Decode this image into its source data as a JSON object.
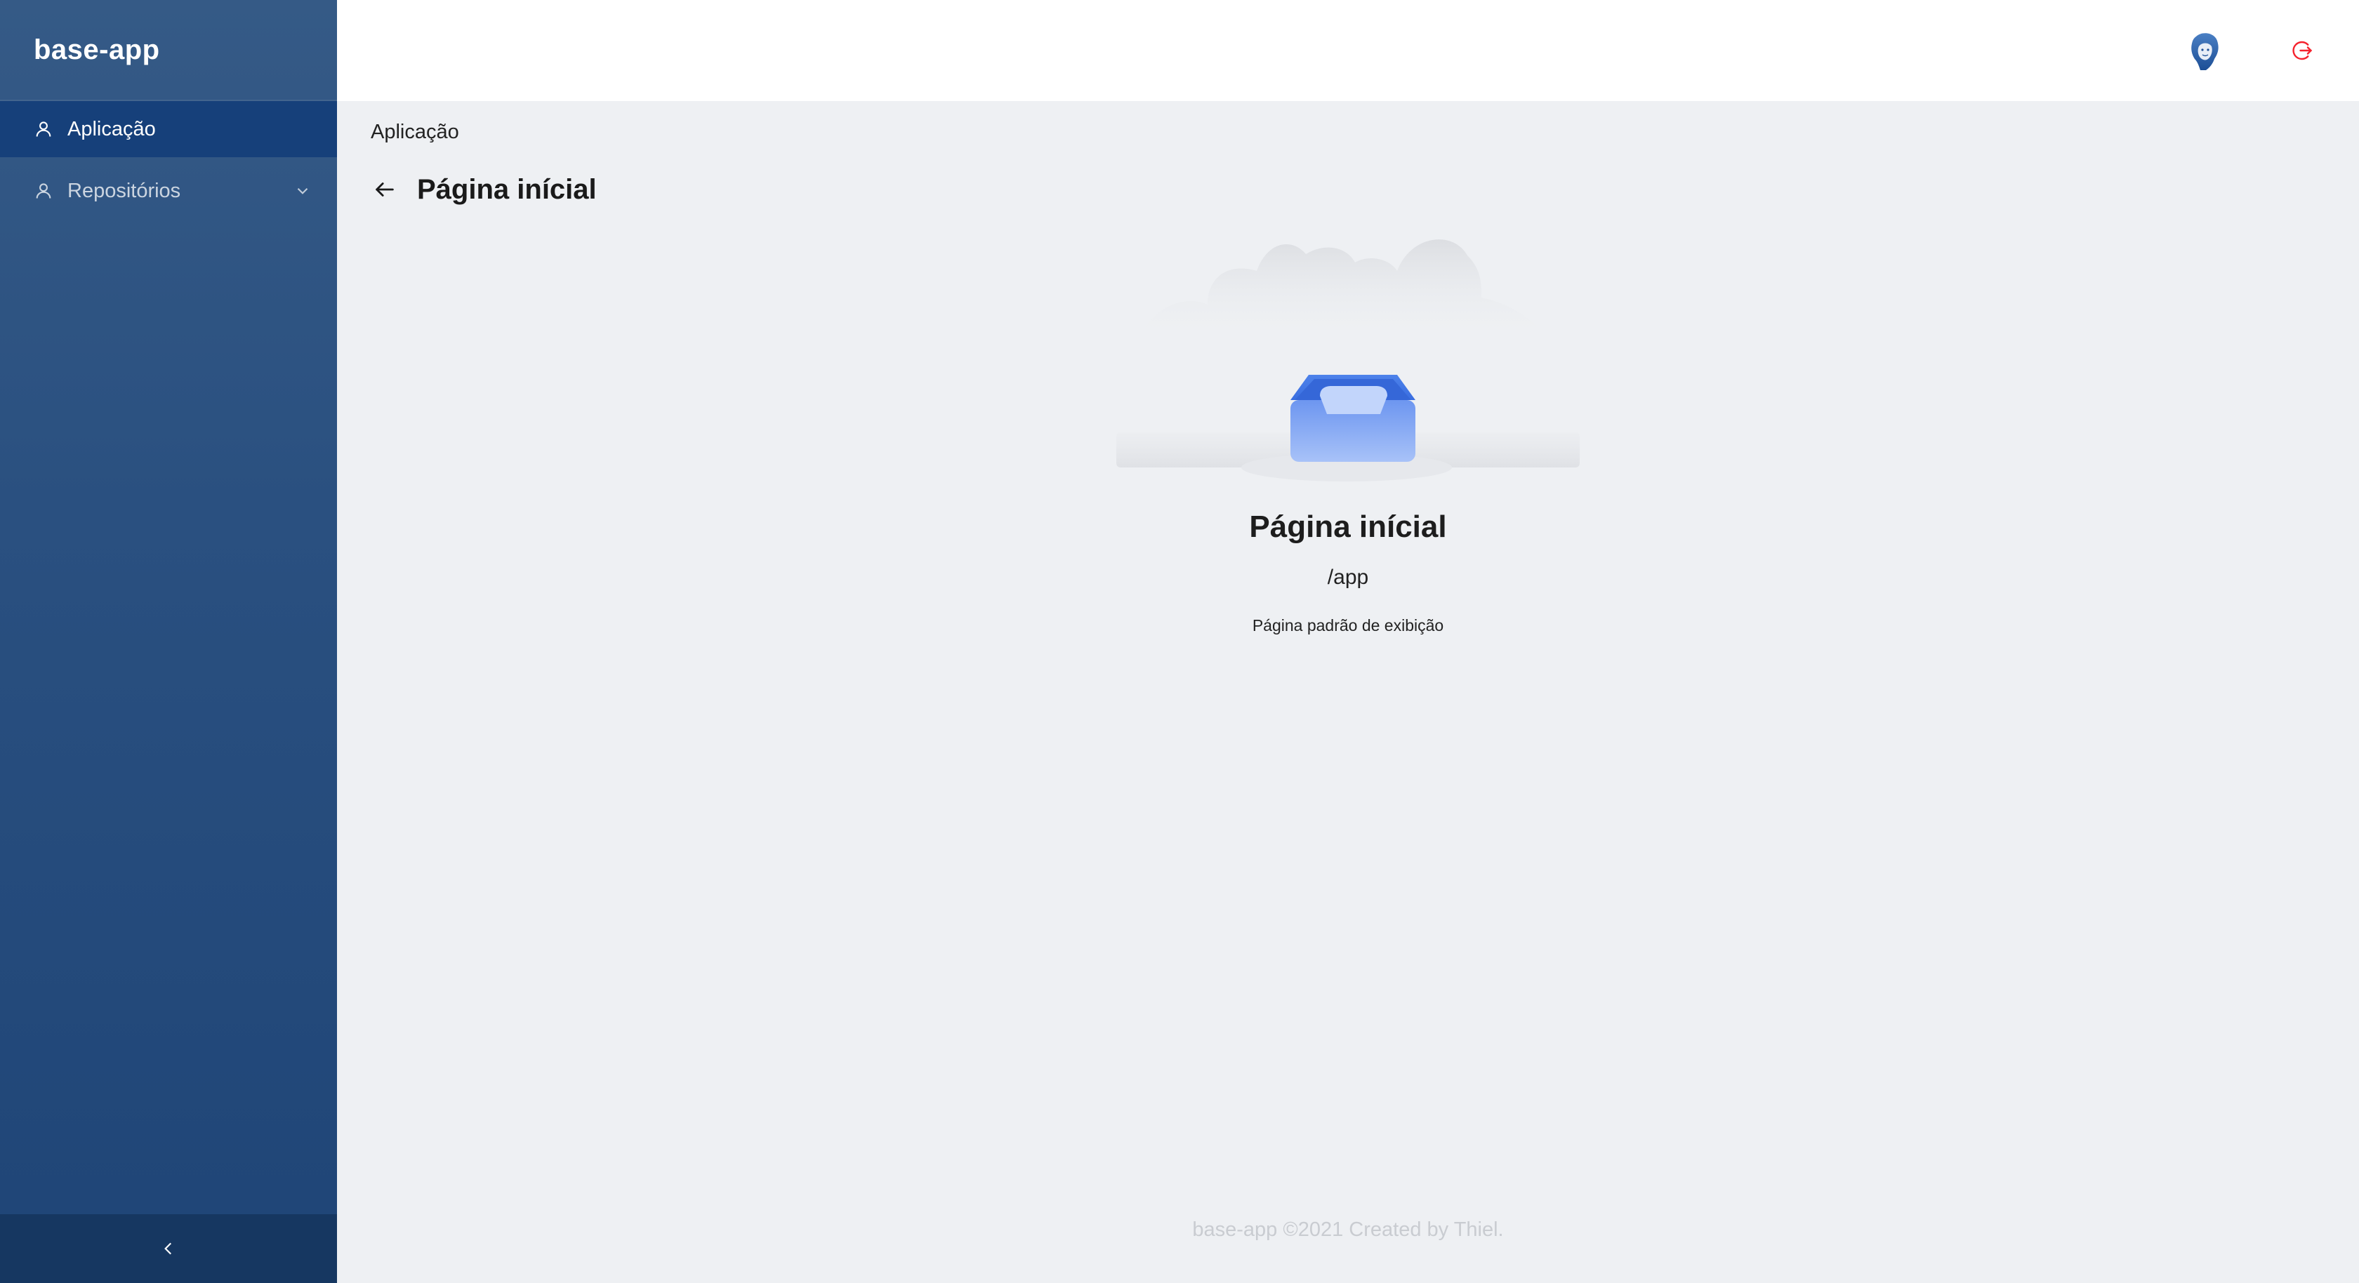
{
  "app": {
    "brand": "base-app"
  },
  "sidebar": {
    "items": [
      {
        "label": "Aplicação",
        "icon": "user-icon",
        "active": true
      },
      {
        "label": "Repositórios",
        "icon": "user-icon",
        "active": false,
        "expandable": true
      }
    ],
    "collapse_icon": "chevron-left-icon"
  },
  "header": {
    "avatar_icon": "user-avatar",
    "logout_icon": "logout-icon",
    "logout_color": "#f5222d"
  },
  "main": {
    "breadcrumb": "Aplicação",
    "page_title": "Página inícial",
    "empty_state": {
      "title": "Página inícial",
      "subtitle": "/app",
      "description": "Página padrão de exibição",
      "illustration": "empty-inbox-illustration"
    }
  },
  "footer": {
    "text": "base-app ©2021 Created by Thiel."
  },
  "colors": {
    "sidebar_top": "#355a86",
    "sidebar_bottom": "#1f4577",
    "active_item": "#16407a",
    "collapse_bar": "#163761",
    "content_bg": "#eef0f3",
    "accent_blue": "#3f6fe0"
  }
}
